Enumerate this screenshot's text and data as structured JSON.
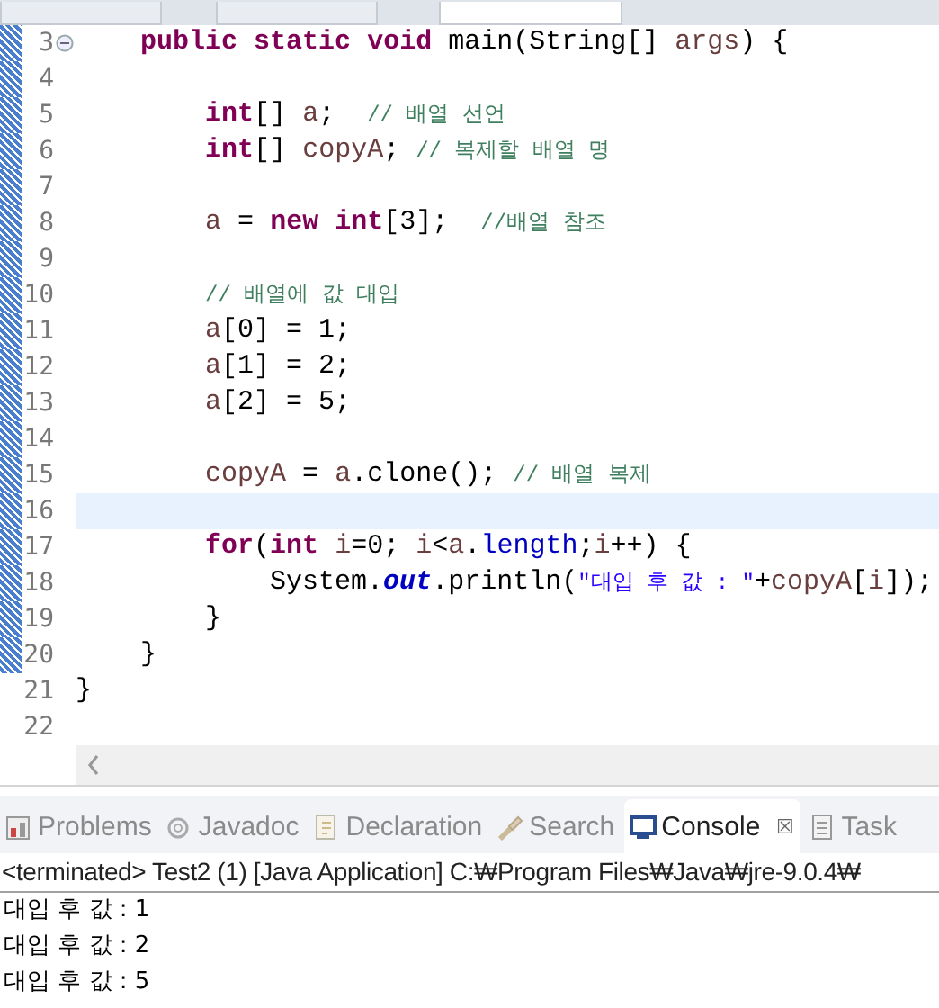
{
  "editor_tabs": [
    {
      "selected": false
    },
    {
      "selected": false
    },
    {
      "selected": true
    }
  ],
  "code_lines": [
    {
      "number": "3",
      "marked": true,
      "current": false,
      "expanded": true,
      "tokens": [
        {
          "kind": "kw",
          "t": "    public"
        },
        {
          "kind": "kw",
          "t": " static"
        },
        {
          "kind": "kw",
          "t": " void"
        },
        {
          "kind": "plain",
          "t": " main(String[]"
        },
        {
          "kind": "var",
          "t": " args"
        },
        {
          "kind": "plain",
          "t": ") {"
        }
      ]
    },
    {
      "number": "4",
      "marked": true,
      "current": false
    },
    {
      "number": "5",
      "marked": true,
      "current": false,
      "tokens": [
        {
          "kind": "kw",
          "t": "        int"
        },
        {
          "kind": "plain",
          "t": "[]"
        },
        {
          "kind": "var",
          "t": " a"
        },
        {
          "kind": "plain",
          "t": ";"
        },
        {
          "kind": "comment",
          "t": "  // 배열 선언"
        }
      ]
    },
    {
      "number": "6",
      "marked": true,
      "current": false,
      "tokens": [
        {
          "kind": "kw",
          "t": "        int"
        },
        {
          "kind": "plain",
          "t": "[]"
        },
        {
          "kind": "var",
          "t": " copyA"
        },
        {
          "kind": "plain",
          "t": ";"
        },
        {
          "kind": "comment",
          "t": " // 복제할 배열 명"
        }
      ]
    },
    {
      "number": "7",
      "marked": true,
      "current": false
    },
    {
      "number": "8",
      "marked": true,
      "current": false,
      "tokens": [
        {
          "kind": "var",
          "t": "        a"
        },
        {
          "kind": "plain",
          "t": " ="
        },
        {
          "kind": "kw",
          "t": " new"
        },
        {
          "kind": "kw",
          "t": " int"
        },
        {
          "kind": "plain",
          "t": "[3];"
        },
        {
          "kind": "comment",
          "t": "  //배열 참조"
        }
      ]
    },
    {
      "number": "9",
      "marked": true,
      "current": false
    },
    {
      "number": "10",
      "marked": true,
      "current": false,
      "tokens": [
        {
          "kind": "comment",
          "t": "        // 배열에 값 대입"
        }
      ]
    },
    {
      "number": "11",
      "marked": true,
      "current": false,
      "tokens": [
        {
          "kind": "var",
          "t": "        a"
        },
        {
          "kind": "plain",
          "t": "[0] = 1;"
        }
      ]
    },
    {
      "number": "12",
      "marked": true,
      "current": false,
      "tokens": [
        {
          "kind": "var",
          "t": "        a"
        },
        {
          "kind": "plain",
          "t": "[1] = 2;"
        }
      ]
    },
    {
      "number": "13",
      "marked": true,
      "current": false,
      "tokens": [
        {
          "kind": "var",
          "t": "        a"
        },
        {
          "kind": "plain",
          "t": "[2] = 5;"
        }
      ]
    },
    {
      "number": "14",
      "marked": true,
      "current": false
    },
    {
      "number": "15",
      "marked": true,
      "current": false,
      "tokens": [
        {
          "kind": "var",
          "t": "        copyA"
        },
        {
          "kind": "plain",
          "t": " ="
        },
        {
          "kind": "var",
          "t": " a"
        },
        {
          "kind": "plain",
          "t": ".clone();"
        },
        {
          "kind": "comment",
          "t": " // 배열 복제"
        }
      ]
    },
    {
      "number": "16",
      "marked": true,
      "current": true
    },
    {
      "number": "17",
      "marked": true,
      "current": false,
      "tokens": [
        {
          "kind": "kw",
          "t": "        for"
        },
        {
          "kind": "plain",
          "t": "("
        },
        {
          "kind": "kw",
          "t": "int"
        },
        {
          "kind": "var",
          "t": " i"
        },
        {
          "kind": "plain",
          "t": "=0;"
        },
        {
          "kind": "var",
          "t": " i"
        },
        {
          "kind": "plain",
          "t": "<"
        },
        {
          "kind": "var",
          "t": "a"
        },
        {
          "kind": "plain",
          "t": "."
        },
        {
          "kind": "field",
          "t": "length"
        },
        {
          "kind": "plain",
          "t": ";"
        },
        {
          "kind": "var",
          "t": "i"
        },
        {
          "kind": "plain",
          "t": "++) {"
        }
      ]
    },
    {
      "number": "18",
      "marked": true,
      "current": false,
      "tokens": [
        {
          "kind": "plain",
          "t": "            System."
        },
        {
          "kind": "static",
          "t": "out"
        },
        {
          "kind": "plain",
          "t": ".println("
        },
        {
          "kind": "string",
          "t": "\"대입 후 값 : \""
        },
        {
          "kind": "plain",
          "t": "+"
        },
        {
          "kind": "var",
          "t": "copyA"
        },
        {
          "kind": "plain",
          "t": "["
        },
        {
          "kind": "var",
          "t": "i"
        },
        {
          "kind": "plain",
          "t": "]);"
        }
      ]
    },
    {
      "number": "19",
      "marked": true,
      "current": false,
      "tokens": [
        {
          "kind": "plain",
          "t": "        }"
        }
      ]
    },
    {
      "number": "20",
      "marked": true,
      "current": false,
      "tokens": [
        {
          "kind": "plain",
          "t": "    }"
        }
      ]
    },
    {
      "number": "21",
      "marked": false,
      "current": false,
      "tokens": [
        {
          "kind": "plain",
          "t": "}"
        }
      ]
    },
    {
      "number": "22",
      "marked": false,
      "current": false
    }
  ],
  "panel_tabs": [
    {
      "label": "Problems",
      "kind": "problems",
      "selected": false
    },
    {
      "label": "Javadoc",
      "kind": "javadoc",
      "selected": false
    },
    {
      "label": "Declaration",
      "kind": "declaration",
      "selected": false
    },
    {
      "label": "Search",
      "kind": "search",
      "selected": false
    },
    {
      "label": "Console",
      "kind": "console",
      "selected": true,
      "close": "☒"
    },
    {
      "label": "Task",
      "kind": "task",
      "selected": false
    }
  ],
  "console": {
    "header": "<terminated> Test2 (1) [Java Application] C:₩Program Files₩Java₩jre-9.0.4₩",
    "output": [
      "대입 후 값 : 1",
      "대입 후 값 : 2",
      "대입 후 값 : 5"
    ]
  }
}
